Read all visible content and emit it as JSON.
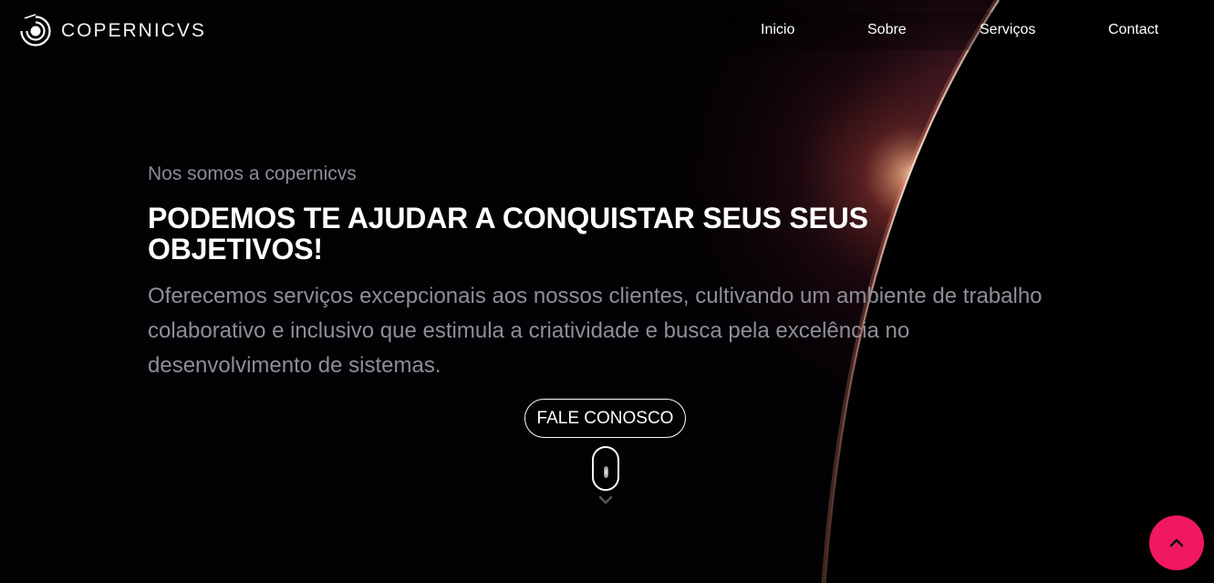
{
  "brand": {
    "logo_text": "COPERNICVS",
    "logo_icon": "copernicus-orbit-icon"
  },
  "nav": {
    "items": [
      {
        "label": "Inicio"
      },
      {
        "label": "Sobre"
      },
      {
        "label": "Serviços"
      },
      {
        "label": "Contact"
      }
    ]
  },
  "hero": {
    "kicker": "Nos somos a copernicvs",
    "headline": "PODEMOS TE AJUDAR A CONQUISTAR SEUS SEUS OBJETIVOS!",
    "description": "Oferecemos serviços excepcionais aos nossos clientes, cultivando um ambiente de trabalho colaborativo e inclusivo que estimula a criatividade e busca pela excelência no desenvolvimento de sistemas.",
    "cta_label": "FALE CONOSCO",
    "scroll_icon": "mouse-scroll-icon",
    "scroll_chevron_icon": "chevron-down-icon"
  },
  "back_to_top": {
    "icon": "chevron-up-icon"
  },
  "colors": {
    "background": "#020103",
    "accent": "#f0185f",
    "text_primary": "#ffffff",
    "text_muted": "#8e8e99",
    "glow": "#ffd6b8"
  }
}
